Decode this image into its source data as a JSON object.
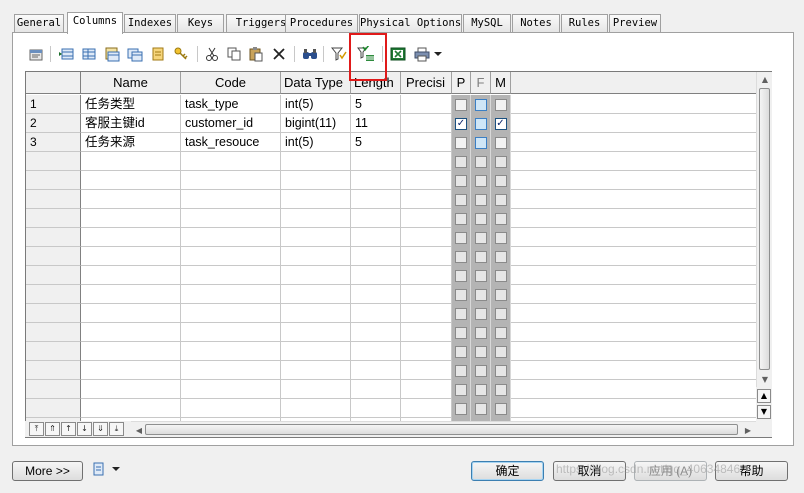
{
  "tabs": [
    "General",
    "Columns",
    "Indexes",
    "Keys",
    "Triggers",
    "Procedures",
    "Physical Options",
    "MySQL",
    "Notes",
    "Rules",
    "Preview"
  ],
  "active_tab": "Columns",
  "toolbar": {
    "icons": [
      "properties-icon",
      "insert-row-icon",
      "add-row-icon",
      "add-columns-icon",
      "replicate-columns-icon",
      "new-key-icon",
      "cut-icon",
      "copy-icon",
      "paste-icon",
      "delete-icon",
      "find-icon",
      "filter-icon",
      "customize-columns-filter-icon",
      "excel-export-icon",
      "print-icon",
      "dropdown-arrow-icon"
    ]
  },
  "grid": {
    "headers": {
      "name": "Name",
      "code": "Code",
      "datatype": "Data Type",
      "length": "Length",
      "precision": "Precisi",
      "p": "P",
      "f": "F",
      "m": "M"
    },
    "rows": [
      {
        "num": "1",
        "name": "任务类型",
        "code": "task_type",
        "datatype": "int(5)",
        "length": "5",
        "precision": "",
        "p": false,
        "f": false,
        "m": false
      },
      {
        "num": "2",
        "name": "客服主键id",
        "code": "customer_id",
        "datatype": "bigint(11)",
        "length": "11",
        "precision": "",
        "p": true,
        "f": false,
        "m": true
      },
      {
        "num": "3",
        "name": "任务来源",
        "code": "task_resouce",
        "datatype": "int(5)",
        "length": "5",
        "precision": "",
        "p": false,
        "f": false,
        "m": false
      }
    ]
  },
  "buttons": {
    "more": "More >>",
    "ok": "确定",
    "cancel": "取消",
    "apply": "应用 (A)",
    "help": "帮助"
  },
  "watermark": "https://blog.csdn.net/qq_40634846",
  "colors": {
    "highlight": "#e01a1a",
    "checkbox_column": "#b4b4b4",
    "focus_checkbox": "#cfe6f7"
  }
}
